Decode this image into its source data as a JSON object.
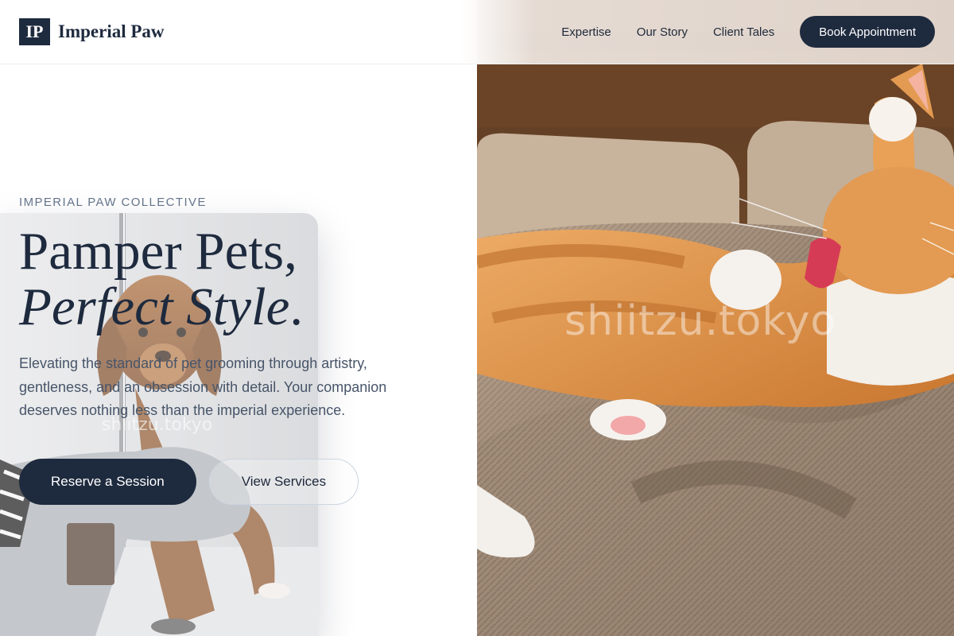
{
  "header": {
    "logo_mark": "IP",
    "brand_name": "Imperial Paw",
    "nav": [
      {
        "label": "Expertise"
      },
      {
        "label": "Our Story"
      },
      {
        "label": "Client Tales"
      }
    ],
    "cta_label": "Book Appointment"
  },
  "hero": {
    "eyebrow": "IMPERIAL PAW COLLECTIVE",
    "headline_line1": "Pamper Pets,",
    "headline_line2_italic": "Perfect Style",
    "headline_line2_end": ".",
    "lede": "Elevating the standard of pet grooming through artistry, gentleness, and an obsession with detail. Your companion deserves nothing less than the imperial experience.",
    "primary_button": "Reserve a Session",
    "secondary_button": "View Services"
  },
  "images": {
    "dog_watermark": "shiitzu.tokyo",
    "cat_watermark": "shiitzu.tokyo"
  },
  "colors": {
    "navy": "#1e2a3e",
    "muted_text": "#475569",
    "eyebrow_text": "#64748b"
  }
}
